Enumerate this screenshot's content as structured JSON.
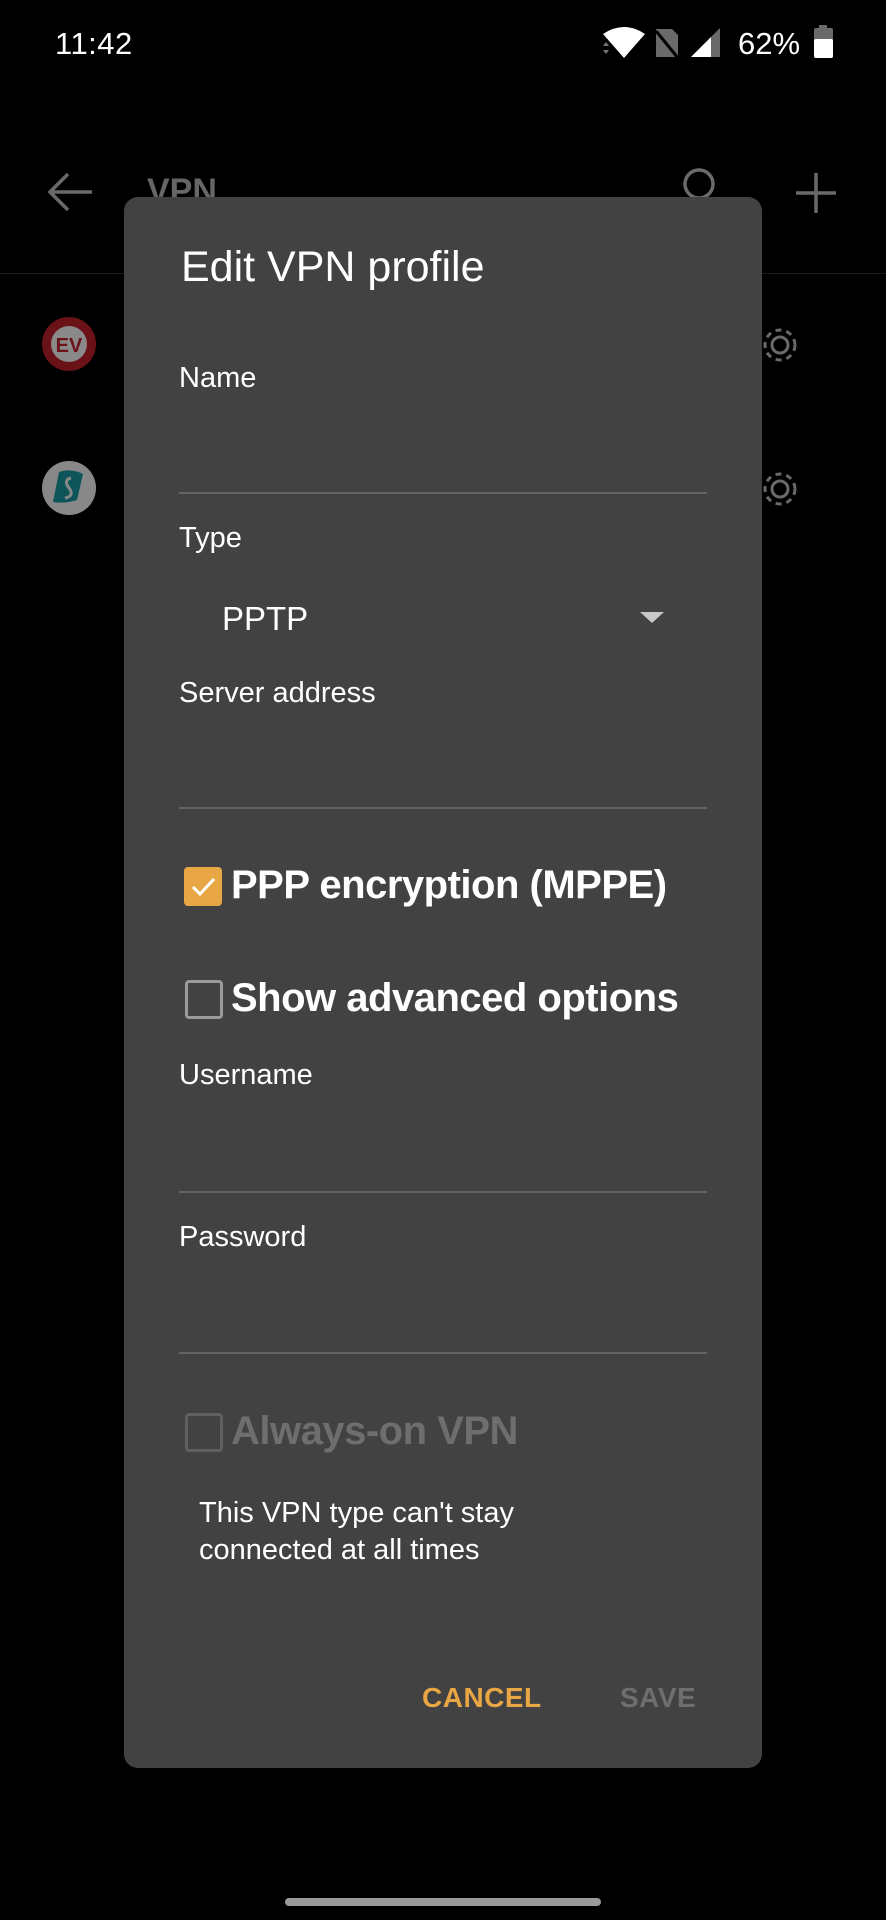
{
  "status_bar": {
    "time": "11:42",
    "battery_percent": "62%",
    "icons": [
      "wifi-icon",
      "no-sim-icon",
      "cell-signal-icon",
      "battery-icon"
    ]
  },
  "background_screen": {
    "app_bar": {
      "title": "VPN",
      "back_icon": "arrow-left-icon",
      "actions": [
        "search-icon",
        "plus-icon"
      ]
    },
    "vpn_list": [
      {
        "app": "ExpressVPN",
        "icon": "expressvpn-logo",
        "settings_icon": "gear-icon"
      },
      {
        "app": "Surfshark",
        "icon": "surfshark-logo",
        "settings_icon": "gear-icon"
      }
    ]
  },
  "dialog": {
    "title": "Edit VPN profile",
    "fields": {
      "name": {
        "label": "Name",
        "value": ""
      },
      "type": {
        "label": "Type",
        "selected": "PPTP"
      },
      "server_address": {
        "label": "Server address",
        "value": ""
      },
      "username": {
        "label": "Username",
        "value": ""
      },
      "password": {
        "label": "Password",
        "value": ""
      }
    },
    "checkboxes": {
      "ppp_encryption": {
        "label": "PPP encryption (MPPE)",
        "checked": true,
        "enabled": true
      },
      "show_advanced": {
        "label": "Show advanced options",
        "checked": false,
        "enabled": true
      },
      "always_on": {
        "label": "Always-on VPN",
        "checked": false,
        "enabled": false
      }
    },
    "always_on_help": "This VPN type can't stay connected at all times",
    "buttons": {
      "cancel": "CANCEL",
      "save": "SAVE"
    }
  },
  "colors": {
    "accent": "#e8a644",
    "dialog_background": "#424242",
    "disabled_text": "#6e6e6e"
  }
}
